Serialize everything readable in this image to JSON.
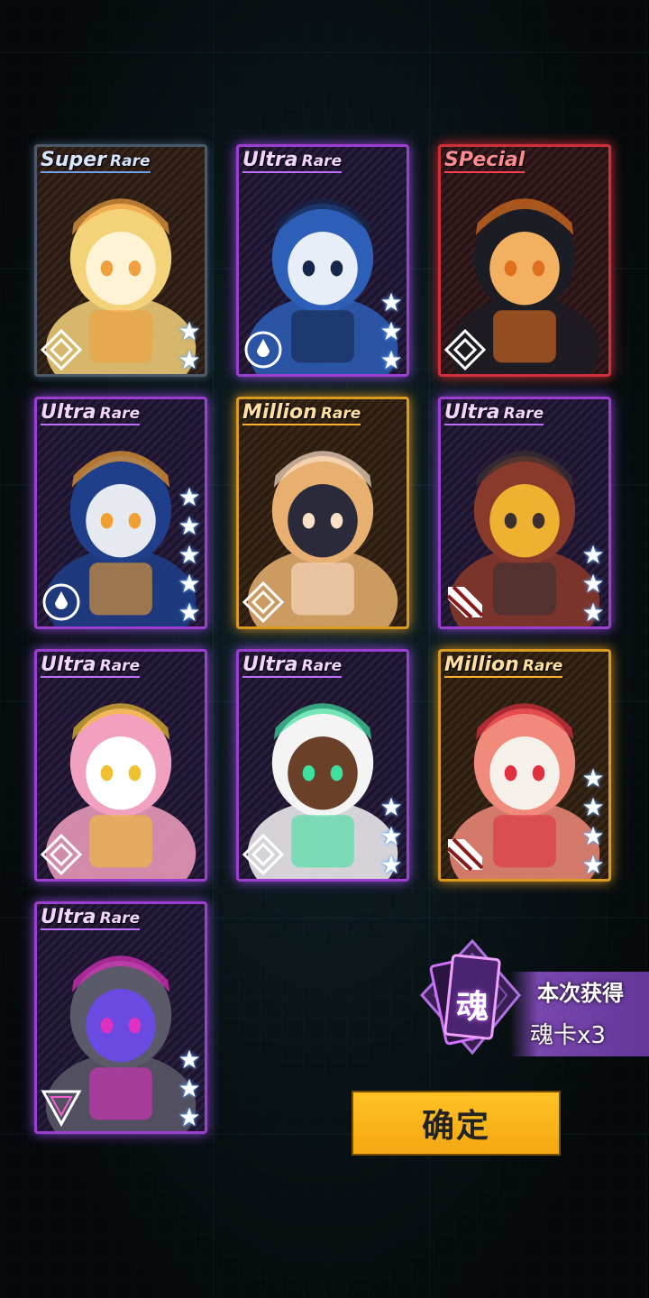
{
  "cards": [
    {
      "rarity_main": "Super",
      "rarity_sub": "Rare",
      "tier": "sr",
      "stars": 2,
      "emblem": "diamond-emblem-icon",
      "art": "blonde-chibi"
    },
    {
      "rarity_main": "Ultra",
      "rarity_sub": "Rare",
      "tier": "ur",
      "stars": 3,
      "emblem": "drop-circle-emblem-icon",
      "art": "blue-mech"
    },
    {
      "rarity_main": "SPecial",
      "rarity_sub": "",
      "tier": "sp",
      "stars": 0,
      "emblem": "diamond-emblem-icon",
      "art": "officer-girl"
    },
    {
      "rarity_main": "Ultra",
      "rarity_sub": "Rare",
      "tier": "ur",
      "stars": 5,
      "emblem": "drop-circle-emblem-icon",
      "art": "blue-mech-dog"
    },
    {
      "rarity_main": "Million",
      "rarity_sub": "Rare",
      "tier": "mr",
      "stars": 0,
      "emblem": "diamond-emblem-icon",
      "art": "twintail-girl"
    },
    {
      "rarity_main": "Ultra",
      "rarity_sub": "Rare",
      "tier": "ur",
      "stars": 3,
      "emblem": "stripes-emblem-icon",
      "art": "mask-chibi"
    },
    {
      "rarity_main": "Ultra",
      "rarity_sub": "Rare",
      "tier": "ur",
      "stars": 0,
      "emblem": "diamond-emblem-icon",
      "art": "pink-hair-girl"
    },
    {
      "rarity_main": "Ultra",
      "rarity_sub": "Rare",
      "tier": "ur",
      "stars": 3,
      "emblem": "diamond-emblem-icon",
      "art": "white-hair-chibi"
    },
    {
      "rarity_main": "Million",
      "rarity_sub": "Rare",
      "tier": "mr",
      "stars": 4,
      "emblem": "stripes-emblem-icon",
      "art": "eyepatch-chibi"
    },
    {
      "rarity_main": "Ultra",
      "rarity_sub": "Rare",
      "tier": "ur",
      "stars": 3,
      "emblem": "triangle-emblem-icon",
      "art": "purple-mech"
    }
  ],
  "soul_reward": {
    "icon_char": "魂",
    "title": "本次获得",
    "count_text": "魂卡x3"
  },
  "confirm_label": "确定",
  "colors": {
    "sr": "#6fa0e8",
    "ur": "#c070ff",
    "sp": "#ff4050",
    "mr": "#ffb030",
    "button": "#ffbb22"
  }
}
